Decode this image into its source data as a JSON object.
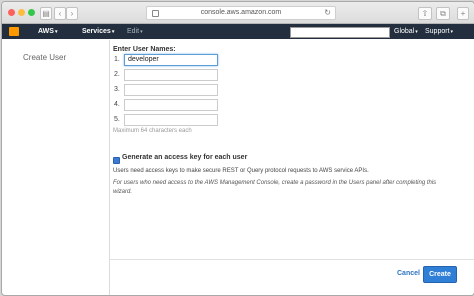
{
  "browser": {
    "url": "console.aws.amazon.com",
    "nav_back": "‹",
    "nav_forward": "›",
    "reload": "↻",
    "share": "⇧",
    "tabs": "⧉"
  },
  "navbar": {
    "brand": "AWS",
    "services": "Services",
    "edit": "Edit",
    "region": "Global",
    "support": "Support",
    "caret": "▾"
  },
  "sidebar": {
    "title": "Create User"
  },
  "form": {
    "enter_label": "Enter User Names:",
    "rows": [
      {
        "num": "1.",
        "value": "developer"
      },
      {
        "num": "2.",
        "value": ""
      },
      {
        "num": "3.",
        "value": ""
      },
      {
        "num": "4.",
        "value": ""
      },
      {
        "num": "5.",
        "value": ""
      }
    ],
    "hint": "Maximum 64 characters each",
    "checkbox_label": "Generate an access key for each user",
    "checkbox_checked": true,
    "access_desc": "Users need access keys to make secure REST or Query protocol requests to AWS service APIs.",
    "console_note": "For users who need access to the AWS Management Console, create a password in the Users panel after completing this wizard."
  },
  "actions": {
    "cancel": "Cancel",
    "create": "Create"
  },
  "colors": {
    "navbar_bg": "#232f3e",
    "accent": "#2f7fd6",
    "aws_orange": "#ff9900"
  }
}
